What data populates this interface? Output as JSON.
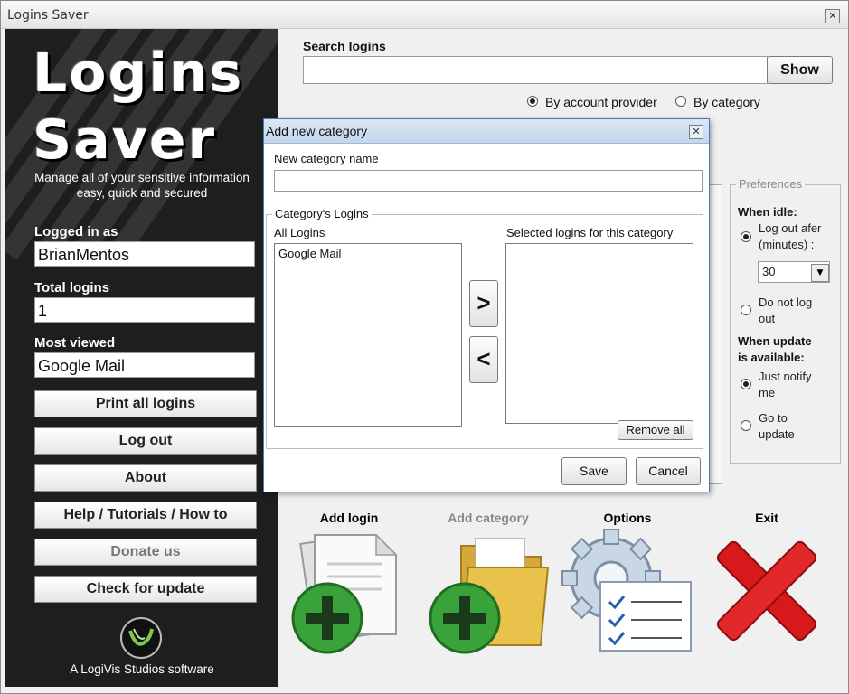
{
  "window": {
    "title": "Logins Saver"
  },
  "sidebar": {
    "logo_line1": "Logins",
    "logo_line2": "Saver",
    "tagline_line1": "Manage all of your sensitive information",
    "tagline_line2": "easy, quick and secured",
    "logged_in_label": "Logged in as",
    "logged_in_value": "BrianMentos",
    "total_logins_label": "Total logins",
    "total_logins_value": "1",
    "most_viewed_label": "Most viewed",
    "most_viewed_value": "Google Mail",
    "buttons": {
      "print_all": "Print all logins",
      "log_out": "Log out",
      "about": "About",
      "help": "Help / Tutorials / How to",
      "donate": "Donate us",
      "check_update": "Check for update"
    },
    "footer": "A LogiVis Studios software"
  },
  "search": {
    "label": "Search logins",
    "value": "",
    "show_button": "Show",
    "by_provider": "By account provider",
    "by_category": "By category",
    "selected": "By account provider"
  },
  "preferences": {
    "title": "Preferences",
    "when_idle": "When idle:",
    "logout_after_line1": "Log out afer",
    "logout_after_line2": "(minutes) :",
    "minutes_value": "30",
    "do_not_logout_line1": "Do not log",
    "do_not_logout_line2": "out",
    "when_update_line1": "When update",
    "when_update_line2": "is available:",
    "just_notify_line1": "Just notify",
    "just_notify_line2": "me",
    "go_to_update_line1": "Go to",
    "go_to_update_line2": "update"
  },
  "actions": {
    "add_login": "Add login",
    "add_category": "Add category",
    "options": "Options",
    "exit": "Exit"
  },
  "dialog": {
    "title": "Add new category",
    "name_label": "New category name",
    "name_value": "",
    "group_title": "Category's Logins",
    "all_logins_label": "All Logins",
    "all_logins": [
      "Google Mail"
    ],
    "selected_label": "Selected logins for this category",
    "move_right": ">",
    "move_left": "<",
    "remove_all": "Remove all",
    "save": "Save",
    "cancel": "Cancel"
  },
  "colors": {
    "sidebar_bg": "#1e1e1e",
    "dialog_border": "#4a7ab5",
    "exit_red": "#d8191c",
    "plus_green": "#3aa23a",
    "folder_yellow": "#e8c24a"
  }
}
